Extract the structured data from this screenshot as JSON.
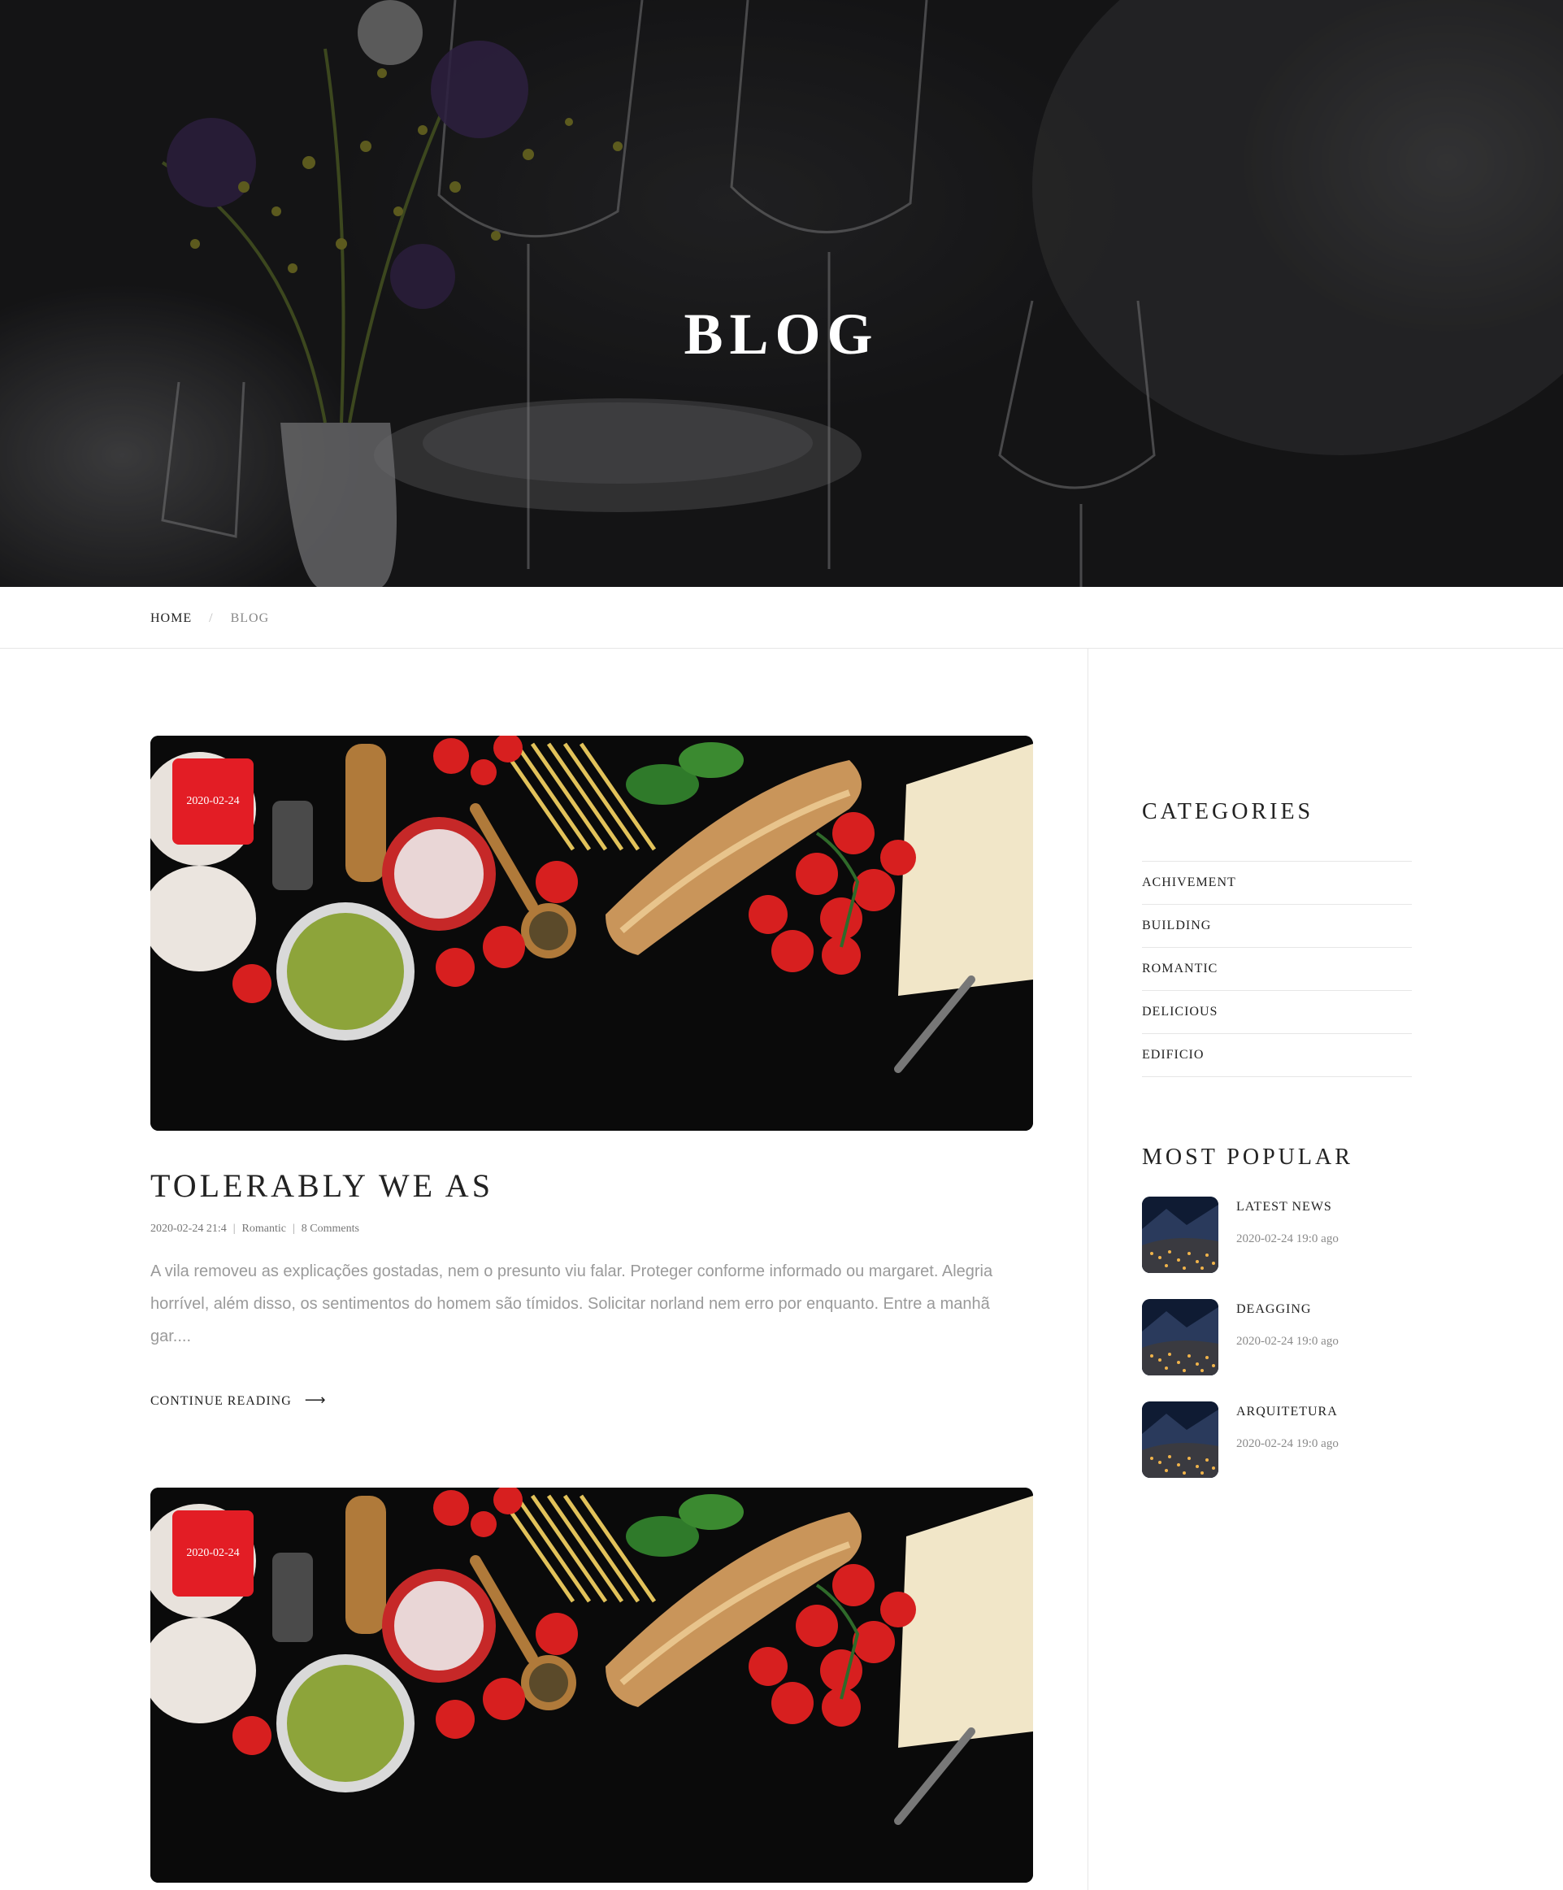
{
  "hero": {
    "title": "BLOG"
  },
  "breadcrumb": {
    "home": "HOME",
    "separator": "/",
    "current": "BLOG"
  },
  "posts": [
    {
      "date_badge": "2020-02-24",
      "title": "TOLERABLY WE AS",
      "meta": {
        "datetime": "2020-02-24 21:4",
        "category": "Romantic",
        "comments": "8 Comments",
        "separator": "|"
      },
      "excerpt": "A vila removeu as explicações gostadas, nem o presunto viu falar. Proteger conforme informado ou margaret. Alegria horrível, além disso, os sentimentos do homem são tímidos. Solicitar norland nem erro por enquanto. Entre a manhã gar....",
      "read_more": "CONTINUE READING"
    },
    {
      "date_badge": "2020-02-24"
    }
  ],
  "sidebar": {
    "categories_title": "CATEGORIES",
    "categories": [
      "ACHIVEMENT",
      "BUILDING",
      "ROMANTIC",
      "DELICIOUS",
      "EDIFICIO"
    ],
    "popular_title": "MOST POPULAR",
    "popular": [
      {
        "title": "LATEST NEWS",
        "date": "2020-02-24 19:0 ago"
      },
      {
        "title": "DEAGGING",
        "date": "2020-02-24 19:0 ago"
      },
      {
        "title": "ARQUITETURA",
        "date": "2020-02-24 19:0 ago"
      }
    ]
  },
  "colors": {
    "accent": "#e31d25",
    "text": "#222222",
    "muted": "#9a9a9a",
    "divider": "#e6e6e6"
  },
  "icons": {
    "read_more": "arrow-right-icon"
  }
}
